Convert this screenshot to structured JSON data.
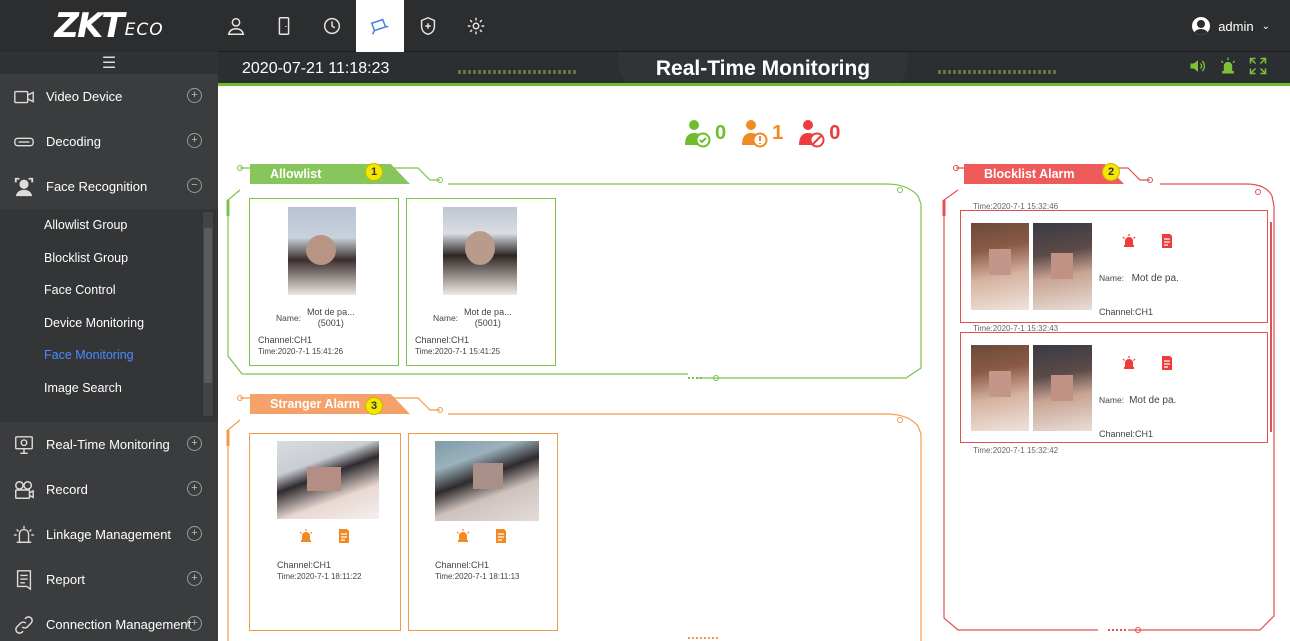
{
  "topbar": {
    "logo_main": "ZKT",
    "logo_sub": "ECO",
    "user": "admin",
    "nav_icons": [
      "person-icon",
      "door-icon",
      "clock-icon",
      "camera-icon",
      "shield-icon",
      "gear-icon"
    ]
  },
  "sidebar": {
    "items": [
      {
        "label": "Video Device",
        "icon": "video-camera-icon"
      },
      {
        "label": "Decoding",
        "icon": "decoder-icon"
      },
      {
        "label": "Face Recognition",
        "icon": "face-icon"
      }
    ],
    "subitems": [
      "Allowlist Group",
      "Blocklist Group",
      "Face Control",
      "Device Monitoring",
      "Face Monitoring",
      "Image Search"
    ],
    "active_subitem": "Face Monitoring",
    "items_bottom": [
      {
        "label": "Real-Time Monitoring",
        "icon": "monitor-icon"
      },
      {
        "label": "Record",
        "icon": "record-icon"
      },
      {
        "label": "Linkage Management",
        "icon": "linkage-icon"
      },
      {
        "label": "Report",
        "icon": "report-icon"
      },
      {
        "label": "Connection Management",
        "icon": "connection-icon"
      }
    ]
  },
  "header": {
    "datetime": "2020-07-21 11:18:23",
    "title": "Real-Time Monitoring"
  },
  "counters": {
    "allow": "0",
    "stranger": "1",
    "block": "0"
  },
  "allowlist": {
    "title": "Allowlist",
    "badge": "1",
    "cards": [
      {
        "name_label": "Name:",
        "name": "Mot de pa...",
        "id": "(5001)",
        "channel": "Channel:CH1",
        "time": "Time:2020-7-1 15:41:26"
      },
      {
        "name_label": "Name:",
        "name": "Mot de pa...",
        "id": "(5001)",
        "channel": "Channel:CH1",
        "time": "Time:2020-7-1 15:41:25"
      }
    ]
  },
  "stranger": {
    "title": "Stranger Alarm",
    "badge": "3",
    "cards": [
      {
        "channel": "Channel:CH1",
        "time": "Time:2020-7-1 18:11:22"
      },
      {
        "channel": "Channel:CH1",
        "time": "Time:2020-7-1 18:11:13"
      }
    ]
  },
  "blocklist": {
    "title": "Blocklist Alarm",
    "badge": "2",
    "cards": [
      {
        "time_above": "Time:2020-7-1 15:32:46",
        "name_label": "Name:",
        "name": "Mot de pa.",
        "channel": "Channel:CH1"
      },
      {
        "time_above": "Time:2020-7-1 15:32:43",
        "name_label": "Name:",
        "name": "Mot de pa.",
        "channel": "Channel:CH1",
        "time_below": "Time:2020-7-1 15:32:42"
      }
    ]
  },
  "colors": {
    "green": "#6fbd2e",
    "orange": "#f08a25",
    "red": "#ee3b3b",
    "dark": "#2b2d2f"
  }
}
